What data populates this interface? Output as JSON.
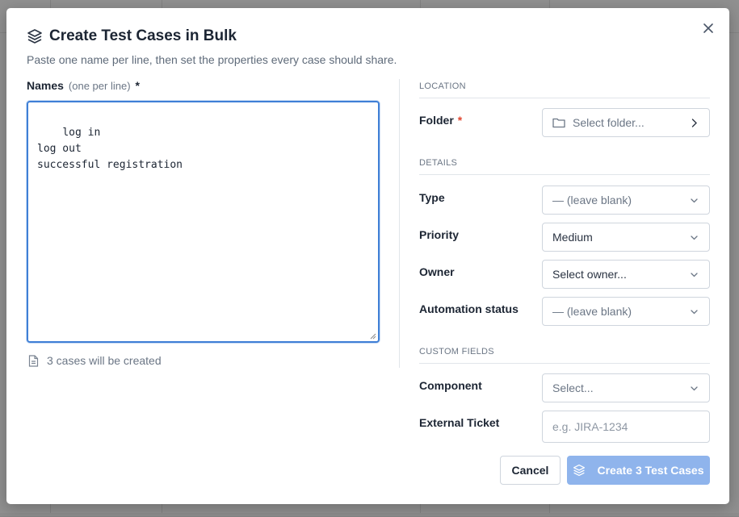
{
  "dialog": {
    "title": "Create Test Cases in Bulk",
    "subtitle": "Paste one name per line, then set the properties every case should share.",
    "icons": {
      "title": "stack-layers-icon",
      "close": "close-icon"
    }
  },
  "names": {
    "label": "Names",
    "hint": "(one per line)",
    "required_marker": "*",
    "value": "log in\nlog out\nsuccessful registration",
    "count_text": "3 cases will be created",
    "count_icon": "document-icon"
  },
  "location": {
    "section_title": "LOCATION",
    "folder": {
      "label": "Folder",
      "required_marker": "*",
      "value": "Select folder...",
      "icon": "folder-icon"
    }
  },
  "details": {
    "section_title": "DETAILS",
    "type": {
      "label": "Type",
      "value": "— (leave blank)"
    },
    "priority": {
      "label": "Priority",
      "value": "Medium"
    },
    "owner": {
      "label": "Owner",
      "value": "Select owner..."
    },
    "automation": {
      "label": "Automation status",
      "value": "— (leave blank)"
    }
  },
  "custom_fields": {
    "section_title": "CUSTOM FIELDS",
    "component": {
      "label": "Component",
      "value": "Select..."
    },
    "external_ticket": {
      "label": "External Ticket",
      "placeholder": "e.g. JIRA-1234"
    }
  },
  "footer": {
    "cancel_label": "Cancel",
    "create_label": "Create 3 Test Cases"
  },
  "colors": {
    "primary_disabled": "#8fb4ec",
    "focus_border": "#3f7fd6",
    "required_red": "#e0452f"
  }
}
